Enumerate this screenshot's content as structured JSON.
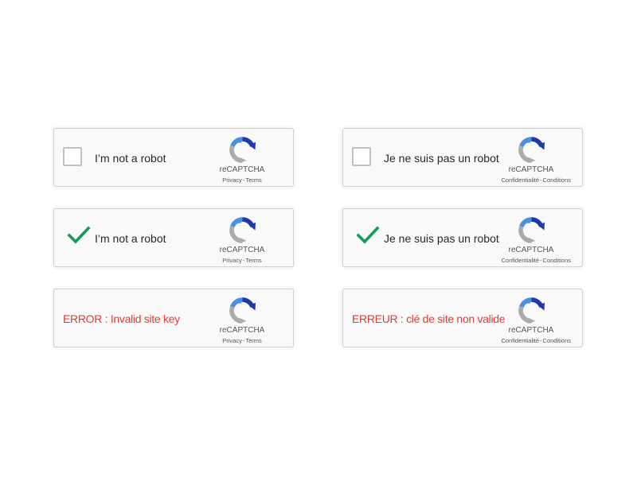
{
  "colors": {
    "widget_background": "#f9f9f9",
    "widget_border": "#d3d3d3",
    "checkbox_border": "#c1c1c1",
    "check_green": "#0f9d58",
    "error_red": "#e53935",
    "logo_dark_blue": "#1c3aa9",
    "logo_blue": "#4a90e2",
    "logo_gray": "#ababab"
  },
  "icons": {
    "logo": "recaptcha-logo-icon",
    "check": "checkmark-icon"
  },
  "widgets": {
    "en_unchecked": {
      "label": "I’m not a robot",
      "brand": "reCAPTCHA",
      "privacy": "Privacy",
      "separator": "-",
      "terms": "Terms"
    },
    "fr_unchecked": {
      "label": "Je ne suis pas un robot",
      "brand": "reCAPTCHA",
      "privacy": "Confidentialité",
      "separator": "-",
      "terms": "Conditions"
    },
    "en_checked": {
      "label": "I’m not a robot",
      "brand": "reCAPTCHA",
      "privacy": "Privacy",
      "separator": "-",
      "terms": "Terms"
    },
    "fr_checked": {
      "label": "Je ne suis pas un robot",
      "brand": "reCAPTCHA",
      "privacy": "Confidentialité",
      "separator": "-",
      "terms": "Conditions"
    },
    "en_error": {
      "error": "ERROR : Invalid site key",
      "brand": "reCAPTCHA",
      "privacy": "Privacy",
      "separator": "-",
      "terms": "Terms"
    },
    "fr_error": {
      "error": "ERREUR : clé de site non valide",
      "brand": "reCAPTCHA",
      "privacy": "Confidentialité",
      "separator": "-",
      "terms": "Conditions"
    }
  }
}
